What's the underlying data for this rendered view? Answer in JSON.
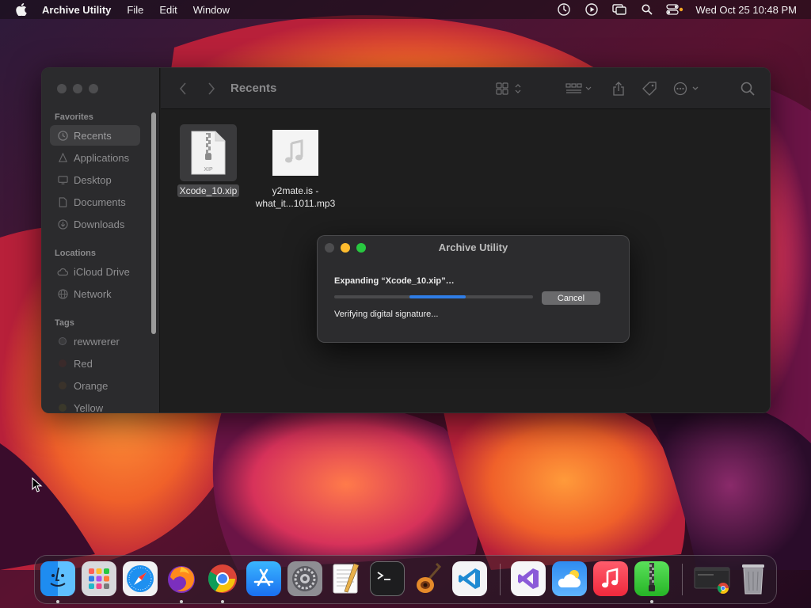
{
  "menubar": {
    "app_name": "Archive Utility",
    "menus": [
      "File",
      "Edit",
      "Window"
    ],
    "clock": "Wed Oct 25  10:48 PM"
  },
  "finder": {
    "title": "Recents",
    "sidebar": {
      "favorites_title": "Favorites",
      "favorites": [
        "Recents",
        "Applications",
        "Desktop",
        "Documents",
        "Downloads"
      ],
      "locations_title": "Locations",
      "locations": [
        "iCloud Drive",
        "Network"
      ],
      "tags_title": "Tags",
      "tags": [
        {
          "label": "rewwrerer",
          "color": "#8e8e93"
        },
        {
          "label": "Red",
          "color": "#ff453a"
        },
        {
          "label": "Orange",
          "color": "#ff9f0a"
        },
        {
          "label": "Yellow",
          "color": "#ffd60a"
        }
      ]
    },
    "files": [
      {
        "name": "Xcode_10.xip",
        "icon": "xip-archive-icon",
        "badge": "XIP"
      },
      {
        "name_line1": "y2mate.is -",
        "name_line2": "what_it...1011.mp3",
        "icon": "audio-file-icon"
      }
    ]
  },
  "dialog": {
    "title": "Archive Utility",
    "message": "Expanding “Xcode_10.xip”…",
    "progress": {
      "start": 0.38,
      "end": 0.66
    },
    "cancel_label": "Cancel",
    "status": "Verifying digital signature..."
  },
  "dock": {
    "apps": [
      "Finder",
      "Launchpad",
      "Safari",
      "Firefox",
      "Google Chrome",
      "App Store",
      "System Settings",
      "TextEdit",
      "Terminal",
      "GarageBand",
      "Visual Studio Code",
      "Visual Studio",
      "Weather",
      "Music",
      "Archive Utility",
      "Chrome Window",
      "Trash"
    ]
  },
  "colors": {
    "traffic_red": "#ff5f57",
    "traffic_yellow": "#febc2e",
    "traffic_green": "#28c840",
    "accent_blue": "#2f7de6"
  }
}
